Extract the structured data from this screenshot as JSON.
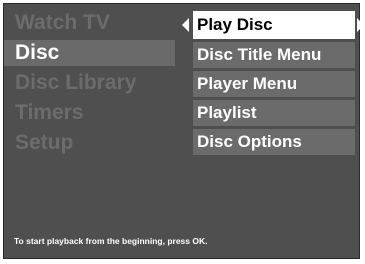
{
  "left_menu": {
    "items": [
      {
        "label": "Watch TV"
      },
      {
        "label": "Disc"
      },
      {
        "label": "Disc Library"
      },
      {
        "label": "Timers"
      },
      {
        "label": "Setup"
      }
    ],
    "active_index": 1
  },
  "right_menu": {
    "items": [
      {
        "label": "Play Disc"
      },
      {
        "label": "Disc Title Menu"
      },
      {
        "label": "Player Menu"
      },
      {
        "label": "Playlist"
      },
      {
        "label": "Disc Options"
      }
    ],
    "active_index": 0
  },
  "hint_text": "To start playback from the beginning, press OK.",
  "colors": {
    "background": "#4f4f4f",
    "item_background": "#6b6b6b",
    "inactive_text": "#6c6c6c",
    "active_text": "#ffffff",
    "highlight": "#ffffff"
  }
}
